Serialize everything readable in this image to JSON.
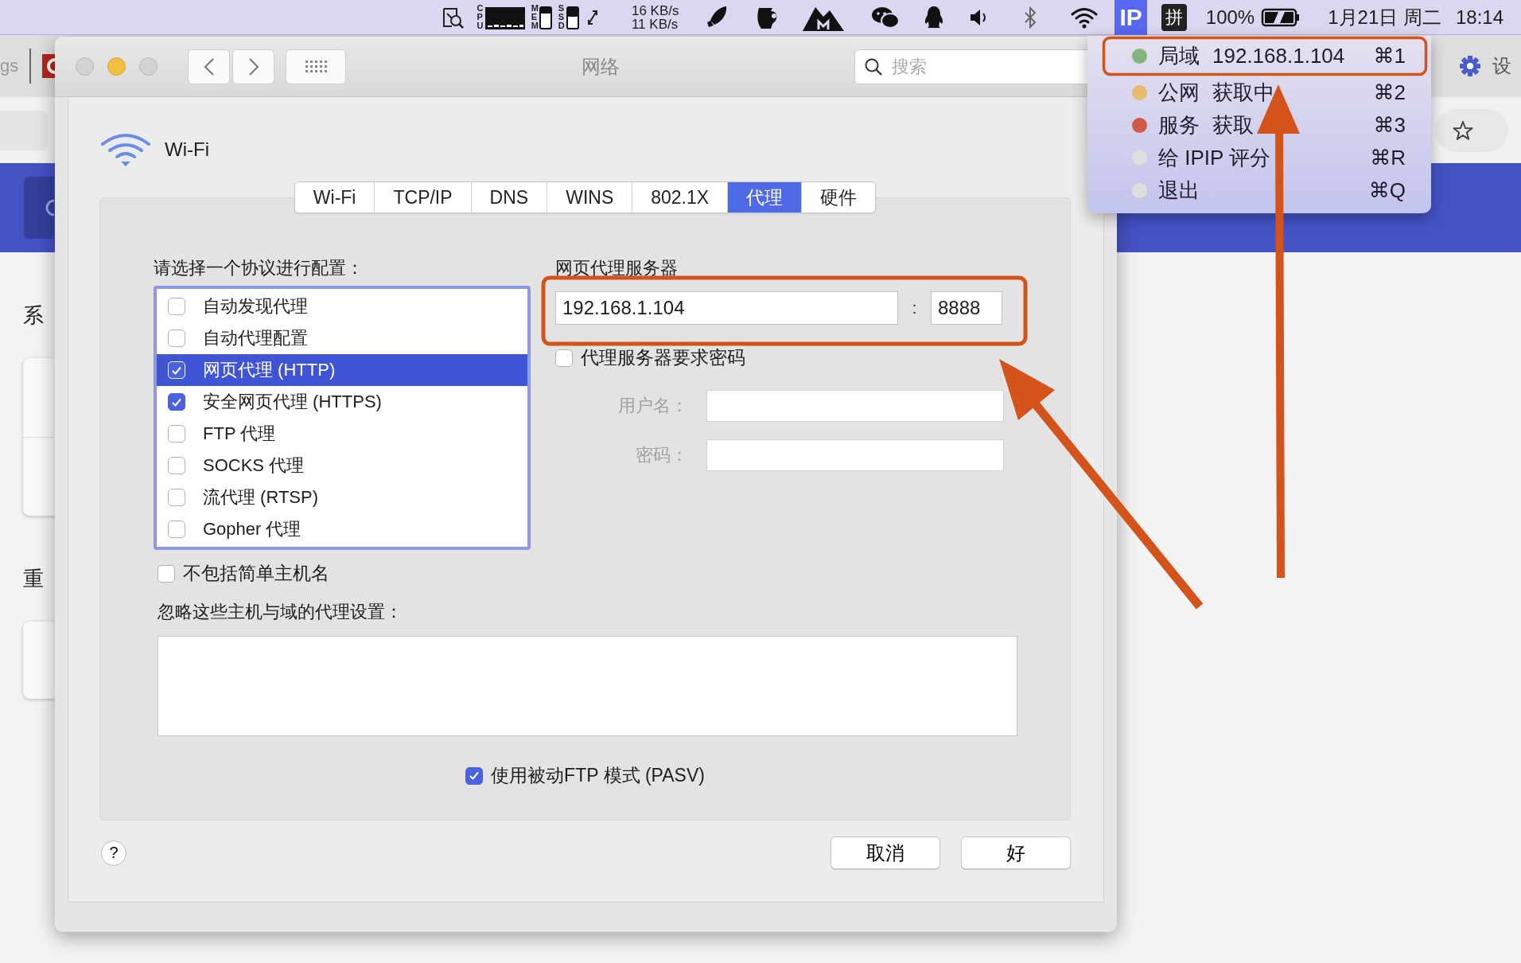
{
  "menu_bar": {
    "cpu_label": "CPU",
    "mem_label": "MEM",
    "ssd_label": "SSD",
    "net_up": "16 KB/s",
    "net_down": "11 KB/s",
    "ip_item": {
      "label": "IP",
      "selected": true
    },
    "input_method": "拼",
    "battery": "100%",
    "date": "1月21日 周二",
    "time": "18:14"
  },
  "ip_menu": {
    "items": [
      {
        "name": "局域",
        "value": "192.168.1.104",
        "shortcut": "⌘1",
        "color": "#84b57c"
      },
      {
        "name": "公网",
        "value": "获取中",
        "shortcut": "⌘2",
        "color": "#e6bb6c"
      },
      {
        "name": "服务",
        "value": "获取",
        "shortcut": "⌘3",
        "color": "#d05a45"
      },
      {
        "name": "给 IPIP 评分",
        "shortcut": "⌘R",
        "color": "#dedede"
      },
      {
        "name": "退出",
        "shortcut": "⌘Q",
        "color": "#dedede"
      }
    ]
  },
  "browser": {
    "tab_text": "gs",
    "section_1": "系",
    "section_2": "重",
    "settings": "设"
  },
  "dialog": {
    "title": "网络",
    "search": {
      "placeholder": "搜索"
    },
    "interface": "Wi-Fi",
    "tabs": [
      {
        "label": "Wi-Fi",
        "selected": false
      },
      {
        "label": "TCP/IP",
        "selected": false
      },
      {
        "label": "DNS",
        "selected": false
      },
      {
        "label": "WINS",
        "selected": false
      },
      {
        "label": "802.1X",
        "selected": false
      },
      {
        "label": "代理",
        "selected": true
      },
      {
        "label": "硬件",
        "selected": false
      }
    ],
    "protocols_label": "请选择一个协议进行配置：",
    "protocols": [
      {
        "label": "自动发现代理",
        "checked": false,
        "selected": false
      },
      {
        "label": "自动代理配置",
        "checked": false,
        "selected": false
      },
      {
        "label": "网页代理 (HTTP)",
        "checked": true,
        "selected": true
      },
      {
        "label": "安全网页代理 (HTTPS)",
        "checked": true,
        "selected": false
      },
      {
        "label": "FTP 代理",
        "checked": false,
        "selected": false
      },
      {
        "label": "SOCKS 代理",
        "checked": false,
        "selected": false
      },
      {
        "label": "流代理 (RTSP)",
        "checked": false,
        "selected": false
      },
      {
        "label": "Gopher 代理",
        "checked": false,
        "selected": false
      }
    ],
    "server_title": "网页代理服务器",
    "server": {
      "host": "192.168.1.104",
      "separator": ":",
      "port": "8888"
    },
    "requires_password": {
      "label": "代理服务器要求密码",
      "checked": false
    },
    "credentials": {
      "disabled": true,
      "username_label": "用户名：",
      "password_label": "密码："
    },
    "exclude_simple": {
      "label": "不包括简单主机名",
      "checked": false
    },
    "bypass_label": "忽略这些主机与域的代理设置：",
    "passive_ftp": {
      "label": "使用被动FTP 模式 (PASV)",
      "checked": true
    },
    "help": "?",
    "buttons": [
      "取消",
      "好"
    ]
  }
}
